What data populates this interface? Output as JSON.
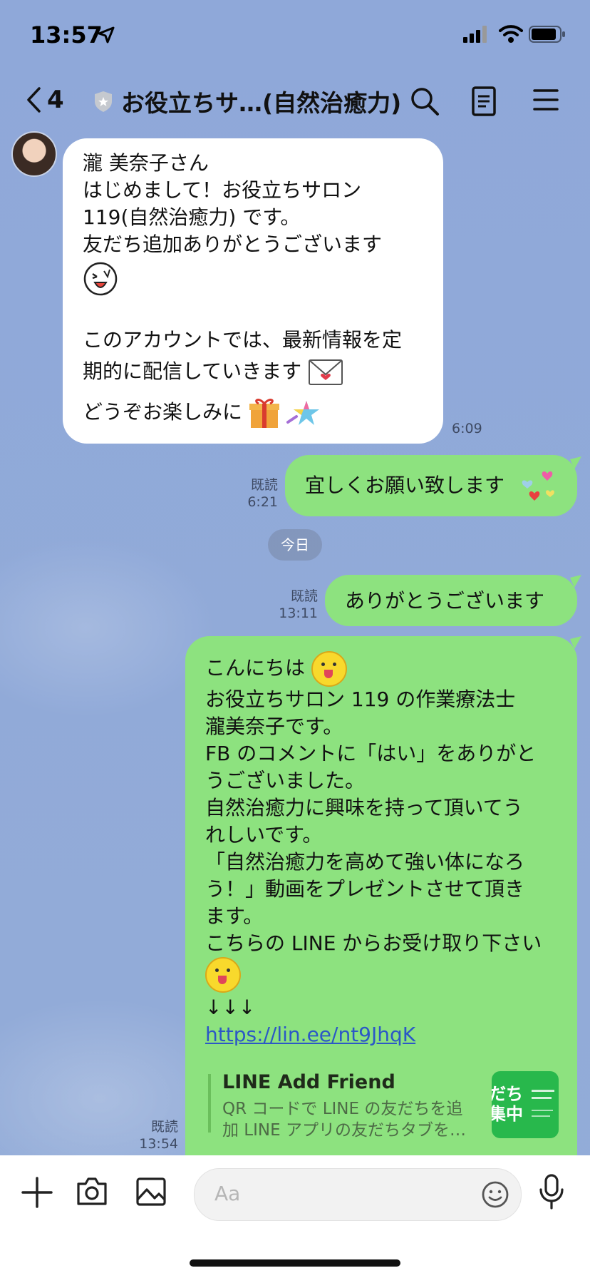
{
  "status_bar": {
    "time": "13:57"
  },
  "nav": {
    "back_count": "4",
    "title": "お役立ちサ…(自然治癒力)",
    "icons": [
      "chevron-left-icon",
      "shield-icon",
      "search-icon",
      "notes-icon",
      "menu-icon"
    ]
  },
  "messages": [
    {
      "direction": "incoming",
      "lines": [
        "瀧 美奈子さん",
        "はじめまして！お役立ちサロン",
        "119(自然治癒力) です。",
        "友だち追加ありがとうございます",
        "",
        "",
        "このアカウントでは、最新情報を定",
        "期的に配信していきます",
        "どうぞお楽しみに"
      ],
      "time": "6:09"
    },
    {
      "direction": "outgoing",
      "text": "宜しくお願い致します",
      "read": "既読",
      "time": "6:21"
    },
    {
      "direction": "separator",
      "text": "今日"
    },
    {
      "direction": "outgoing",
      "text": "ありがとうございます",
      "read": "既読",
      "time": "13:11"
    },
    {
      "direction": "outgoing",
      "lines": [
        "こんにちは",
        "お役立ちサロン 119 の作業療法士",
        "瀧美奈子です。",
        "FB のコメントに「はい」をありがと",
        "うございました。",
        "自然治癒力に興味を持って頂いてう",
        "れしいです。",
        "「自然治癒力を高めて強い体になろ",
        "う！」動画をプレゼントさせて頂き",
        "ます。",
        "こちらの LINE からお受け取り下さい",
        "",
        "↓↓↓"
      ],
      "link": "https://lin.ee/nt9JhqK",
      "preview": {
        "title": "LINE Add Friend",
        "desc_line1": "QR コードで LINE の友だちを追",
        "desc_line2": "加 LINE アプリの友だちタブを…",
        "thumb_line1": "だち",
        "thumb_line2": "集中"
      },
      "read": "既読",
      "time": "13:54"
    }
  ],
  "composer": {
    "placeholder": "Aa",
    "icons": [
      "plus-icon",
      "camera-icon",
      "image-icon",
      "emoji-icon",
      "microphone-icon"
    ]
  },
  "colors": {
    "chat_bg": "#8fa9d8",
    "outgoing_bubble": "#8de27f",
    "incoming_bubble": "#ffffff",
    "link": "#2b58c6"
  }
}
